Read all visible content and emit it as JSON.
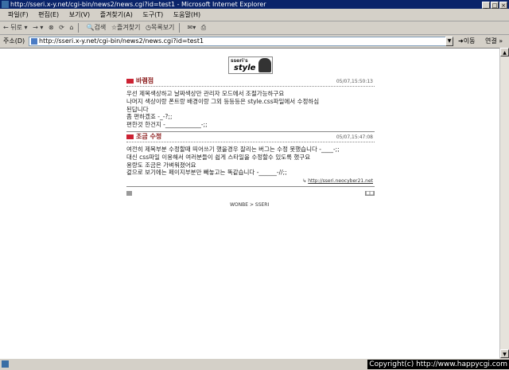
{
  "window": {
    "title": "http://sseri.x-y.net/cgi-bin/news2/news.cgi?id=test1 - Microsoft Internet Explorer",
    "min": "_",
    "max": "□",
    "close": "×"
  },
  "menu": [
    "파일(F)",
    "편집(E)",
    "보기(V)",
    "즐겨찾기(A)",
    "도구(T)",
    "도움말(H)"
  ],
  "toolbar": {
    "back": "← 뒤로 ▾",
    "forward": "→ ▾",
    "search": "검색",
    "favorites": "즐겨찾기",
    "history": "목록보기"
  },
  "address": {
    "label": "주소(D)",
    "url": "http://sseri.x-y.net/cgi-bin/news2/news.cgi?id=test1",
    "go": "이동",
    "links": "연결 »"
  },
  "logo": {
    "top": "sseri's",
    "main": "style"
  },
  "posts": [
    {
      "name": "바램점",
      "date": "05/07,15:50:13",
      "body": "우선 제목색상하고 날짜색상만 관리자 모드에서 조절가능하구요\n나머지 색상이랑 폰트랑 배경이랑 그외 등등등은 style.css파일에서 수정하심\n된답니다\n좀 편하겠죠 -_-?;;\n편한것 한건지 -____________-;;"
    },
    {
      "name": "조금 수정",
      "date": "05/07,15:47:08",
      "body": "여전히 제목부분 수정할때 띄어쓰기 했을경우 잘리는 버그는 수정 못했습니다 -____-;;\n대신 css파일 이용해서 여러분들이 쉽게 스타일을 수정할수 있도록 했구요\n용량도 조금은 가벼워졌어요\n겉으로 보기에는 페이지부분만 빼놓고는 똑같습니다 -______-//;;",
      "link": "http://sseri.neocyber21.net"
    }
  ],
  "credit": "WONBE > SSERI",
  "status": {
    "copyright": "Copyright(c) http://www.happycgi.com"
  }
}
